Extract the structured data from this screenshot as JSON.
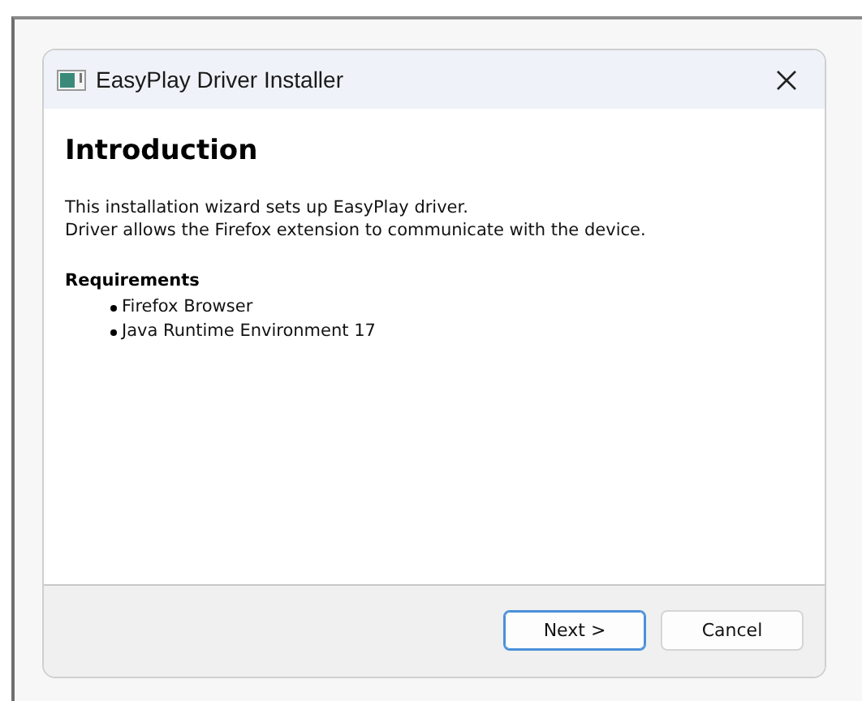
{
  "window": {
    "title": "EasyPlay Driver Installer"
  },
  "page": {
    "heading": "Introduction",
    "paragraphs": [
      "This installation wizard sets up EasyPlay driver.",
      "Driver allows the Firefox extension to communicate with the device."
    ],
    "requirements_title": "Requirements",
    "requirements": [
      "Firefox Browser",
      "Java Runtime Environment 17"
    ]
  },
  "buttons": [
    {
      "label": "Next >",
      "default": true
    },
    {
      "label": "Cancel",
      "default": false
    }
  ]
}
